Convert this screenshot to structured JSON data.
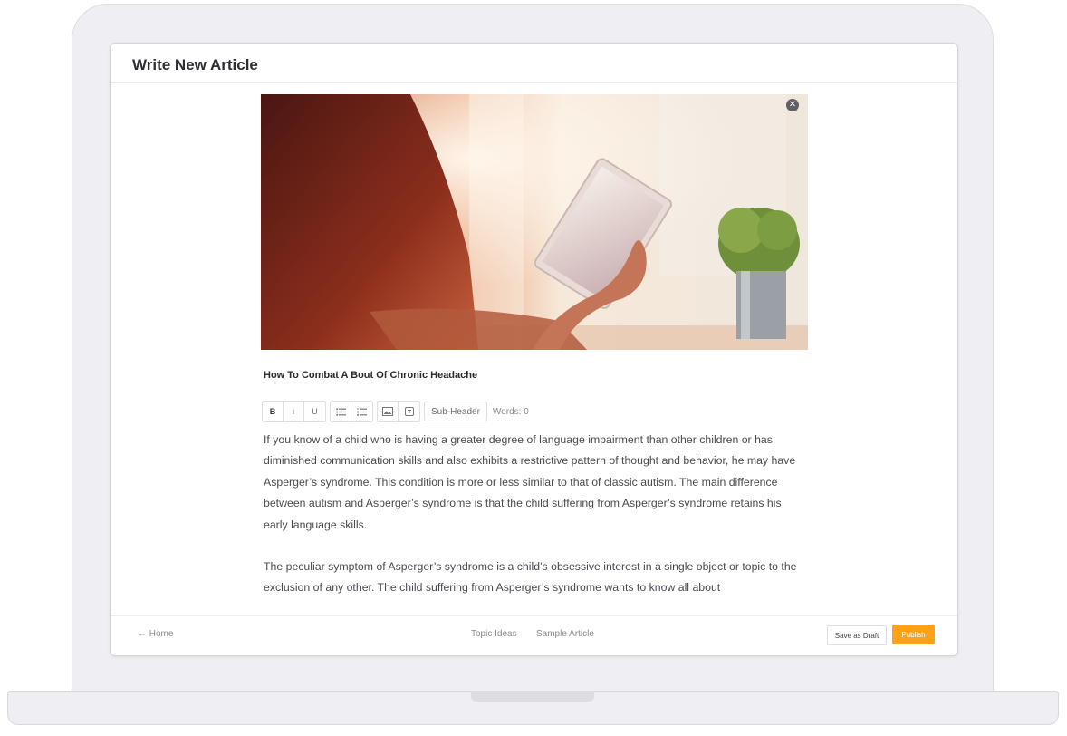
{
  "page": {
    "title": "Write New Article"
  },
  "article": {
    "title": "How To Combat A Bout Of Chronic Headache",
    "paragraphs": [
      "If you know of a child who is having a greater degree of language impairment than other children or has diminished communication skills and also exhibits a restrictive pattern of thought and behavior, he may have Asperger’s syndrome. This condition is more or less similar to that of classic autism. The main difference between autism and Asperger’s syndrome is that the child suffering from Asperger’s syndrome retains his early language skills.",
      "The peculiar symptom of Asperger’s syndrome is a child’s obsessive interest in a single object or topic to the exclusion of any other. The child suffering from Asperger’s syndrome wants to know all about"
    ]
  },
  "hero_image": {
    "close_icon": "close-icon"
  },
  "toolbar": {
    "bold": "B",
    "italic": "i",
    "underline": "U",
    "subheader": "Sub-Header",
    "word_count": "Words: 0"
  },
  "footer": {
    "home": "← Home",
    "topic_ideas": "Topic Ideas",
    "sample_article": "Sample Article",
    "save_draft": "Save as Draft",
    "publish": "Publish"
  },
  "colors": {
    "accent": "#ffa21a",
    "frame": "#efeff3"
  }
}
